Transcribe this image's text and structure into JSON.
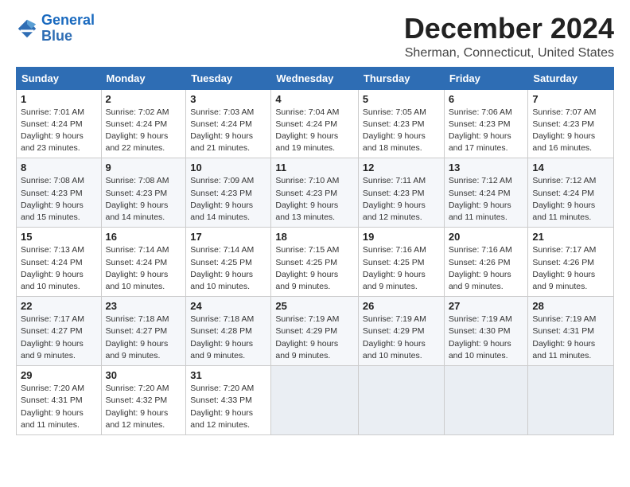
{
  "logo": {
    "text_general": "General",
    "text_blue": "Blue"
  },
  "title": "December 2024",
  "subtitle": "Sherman, Connecticut, United States",
  "headers": [
    "Sunday",
    "Monday",
    "Tuesday",
    "Wednesday",
    "Thursday",
    "Friday",
    "Saturday"
  ],
  "weeks": [
    [
      {
        "day": "1",
        "sunrise": "Sunrise: 7:01 AM",
        "sunset": "Sunset: 4:24 PM",
        "daylight": "Daylight: 9 hours and 23 minutes."
      },
      {
        "day": "2",
        "sunrise": "Sunrise: 7:02 AM",
        "sunset": "Sunset: 4:24 PM",
        "daylight": "Daylight: 9 hours and 22 minutes."
      },
      {
        "day": "3",
        "sunrise": "Sunrise: 7:03 AM",
        "sunset": "Sunset: 4:24 PM",
        "daylight": "Daylight: 9 hours and 21 minutes."
      },
      {
        "day": "4",
        "sunrise": "Sunrise: 7:04 AM",
        "sunset": "Sunset: 4:24 PM",
        "daylight": "Daylight: 9 hours and 19 minutes."
      },
      {
        "day": "5",
        "sunrise": "Sunrise: 7:05 AM",
        "sunset": "Sunset: 4:23 PM",
        "daylight": "Daylight: 9 hours and 18 minutes."
      },
      {
        "day": "6",
        "sunrise": "Sunrise: 7:06 AM",
        "sunset": "Sunset: 4:23 PM",
        "daylight": "Daylight: 9 hours and 17 minutes."
      },
      {
        "day": "7",
        "sunrise": "Sunrise: 7:07 AM",
        "sunset": "Sunset: 4:23 PM",
        "daylight": "Daylight: 9 hours and 16 minutes."
      }
    ],
    [
      {
        "day": "8",
        "sunrise": "Sunrise: 7:08 AM",
        "sunset": "Sunset: 4:23 PM",
        "daylight": "Daylight: 9 hours and 15 minutes."
      },
      {
        "day": "9",
        "sunrise": "Sunrise: 7:08 AM",
        "sunset": "Sunset: 4:23 PM",
        "daylight": "Daylight: 9 hours and 14 minutes."
      },
      {
        "day": "10",
        "sunrise": "Sunrise: 7:09 AM",
        "sunset": "Sunset: 4:23 PM",
        "daylight": "Daylight: 9 hours and 14 minutes."
      },
      {
        "day": "11",
        "sunrise": "Sunrise: 7:10 AM",
        "sunset": "Sunset: 4:23 PM",
        "daylight": "Daylight: 9 hours and 13 minutes."
      },
      {
        "day": "12",
        "sunrise": "Sunrise: 7:11 AM",
        "sunset": "Sunset: 4:23 PM",
        "daylight": "Daylight: 9 hours and 12 minutes."
      },
      {
        "day": "13",
        "sunrise": "Sunrise: 7:12 AM",
        "sunset": "Sunset: 4:24 PM",
        "daylight": "Daylight: 9 hours and 11 minutes."
      },
      {
        "day": "14",
        "sunrise": "Sunrise: 7:12 AM",
        "sunset": "Sunset: 4:24 PM",
        "daylight": "Daylight: 9 hours and 11 minutes."
      }
    ],
    [
      {
        "day": "15",
        "sunrise": "Sunrise: 7:13 AM",
        "sunset": "Sunset: 4:24 PM",
        "daylight": "Daylight: 9 hours and 10 minutes."
      },
      {
        "day": "16",
        "sunrise": "Sunrise: 7:14 AM",
        "sunset": "Sunset: 4:24 PM",
        "daylight": "Daylight: 9 hours and 10 minutes."
      },
      {
        "day": "17",
        "sunrise": "Sunrise: 7:14 AM",
        "sunset": "Sunset: 4:25 PM",
        "daylight": "Daylight: 9 hours and 10 minutes."
      },
      {
        "day": "18",
        "sunrise": "Sunrise: 7:15 AM",
        "sunset": "Sunset: 4:25 PM",
        "daylight": "Daylight: 9 hours and 9 minutes."
      },
      {
        "day": "19",
        "sunrise": "Sunrise: 7:16 AM",
        "sunset": "Sunset: 4:25 PM",
        "daylight": "Daylight: 9 hours and 9 minutes."
      },
      {
        "day": "20",
        "sunrise": "Sunrise: 7:16 AM",
        "sunset": "Sunset: 4:26 PM",
        "daylight": "Daylight: 9 hours and 9 minutes."
      },
      {
        "day": "21",
        "sunrise": "Sunrise: 7:17 AM",
        "sunset": "Sunset: 4:26 PM",
        "daylight": "Daylight: 9 hours and 9 minutes."
      }
    ],
    [
      {
        "day": "22",
        "sunrise": "Sunrise: 7:17 AM",
        "sunset": "Sunset: 4:27 PM",
        "daylight": "Daylight: 9 hours and 9 minutes."
      },
      {
        "day": "23",
        "sunrise": "Sunrise: 7:18 AM",
        "sunset": "Sunset: 4:27 PM",
        "daylight": "Daylight: 9 hours and 9 minutes."
      },
      {
        "day": "24",
        "sunrise": "Sunrise: 7:18 AM",
        "sunset": "Sunset: 4:28 PM",
        "daylight": "Daylight: 9 hours and 9 minutes."
      },
      {
        "day": "25",
        "sunrise": "Sunrise: 7:19 AM",
        "sunset": "Sunset: 4:29 PM",
        "daylight": "Daylight: 9 hours and 9 minutes."
      },
      {
        "day": "26",
        "sunrise": "Sunrise: 7:19 AM",
        "sunset": "Sunset: 4:29 PM",
        "daylight": "Daylight: 9 hours and 10 minutes."
      },
      {
        "day": "27",
        "sunrise": "Sunrise: 7:19 AM",
        "sunset": "Sunset: 4:30 PM",
        "daylight": "Daylight: 9 hours and 10 minutes."
      },
      {
        "day": "28",
        "sunrise": "Sunrise: 7:19 AM",
        "sunset": "Sunset: 4:31 PM",
        "daylight": "Daylight: 9 hours and 11 minutes."
      }
    ],
    [
      {
        "day": "29",
        "sunrise": "Sunrise: 7:20 AM",
        "sunset": "Sunset: 4:31 PM",
        "daylight": "Daylight: 9 hours and 11 minutes."
      },
      {
        "day": "30",
        "sunrise": "Sunrise: 7:20 AM",
        "sunset": "Sunset: 4:32 PM",
        "daylight": "Daylight: 9 hours and 12 minutes."
      },
      {
        "day": "31",
        "sunrise": "Sunrise: 7:20 AM",
        "sunset": "Sunset: 4:33 PM",
        "daylight": "Daylight: 9 hours and 12 minutes."
      },
      null,
      null,
      null,
      null
    ]
  ]
}
